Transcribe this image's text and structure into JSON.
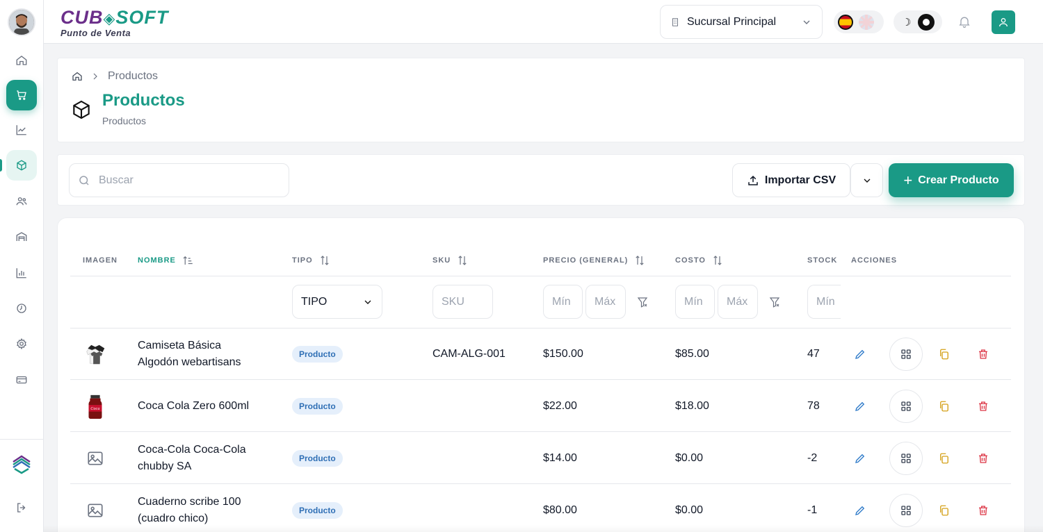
{
  "brand": {
    "name_part1": "CUB",
    "name_part2": "SOFT",
    "subtitle": "Punto de Venta"
  },
  "header": {
    "branch": "Sucursal Principal",
    "languages": [
      "es",
      "en"
    ],
    "theme": "dark-mode-toggle"
  },
  "sidebar": {
    "items": [
      {
        "icon": "home-icon"
      },
      {
        "icon": "cart-icon",
        "state": "active"
      },
      {
        "icon": "chart-line-icon"
      },
      {
        "icon": "box-icon",
        "state": "selected"
      },
      {
        "icon": "users-icon"
      },
      {
        "icon": "building-icon"
      },
      {
        "icon": "bar-chart-icon"
      },
      {
        "icon": "clock-icon"
      },
      {
        "icon": "gear-icon"
      },
      {
        "icon": "credit-card-icon"
      }
    ]
  },
  "page": {
    "breadcrumb": "Productos",
    "title": "Productos",
    "subtitle": "Productos"
  },
  "toolbar": {
    "search_placeholder": "Buscar",
    "import_label": "Importar CSV",
    "create_label": "Crear Producto"
  },
  "table": {
    "headers": {
      "imagen": "IMAGEN",
      "nombre": "NOMBRE",
      "tipo": "TIPO",
      "sku": "SKU",
      "precio": "PRECIO (GENERAL)",
      "costo": "COSTO",
      "stock": "STOCK",
      "acciones": "ACCIONES"
    },
    "filters": {
      "tipo": "TIPO",
      "sku": "SKU",
      "min": "Mín",
      "max": "Máx"
    },
    "rows": [
      {
        "name_line1": "Camiseta Básica",
        "name_line2": "Algodón webartisans",
        "type": "Producto",
        "sku": "CAM-ALG-001",
        "price": "$150.00",
        "cost": "$85.00",
        "stock": "47",
        "image": "tshirt"
      },
      {
        "name_line1": "Coca Cola Zero 600ml",
        "name_line2": "",
        "type": "Producto",
        "sku": "",
        "price": "$22.00",
        "cost": "$18.00",
        "stock": "78",
        "image": "bottle"
      },
      {
        "name_line1": "Coca-Cola Coca-Cola",
        "name_line2": "chubby SA",
        "type": "Producto",
        "sku": "",
        "price": "$14.00",
        "cost": "$0.00",
        "stock": "-2",
        "image": "placeholder"
      },
      {
        "name_line1": "Cuaderno scribe 100",
        "name_line2": "(cuadro chico)",
        "type": "Producto",
        "sku": "",
        "price": "$80.00",
        "cost": "$0.00",
        "stock": "-1",
        "image": "placeholder"
      }
    ]
  },
  "colors": {
    "accent": "#1a9a86",
    "brand_purple": "#6b2f8a",
    "edit": "#2f7bc9",
    "copy": "#d4a017",
    "delete": "#dc3545"
  }
}
